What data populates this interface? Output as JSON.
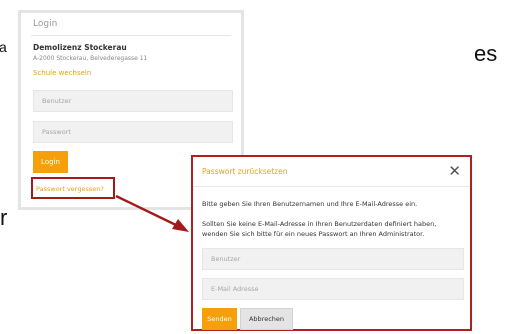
{
  "background_text": {
    "left_char_top": "a",
    "right_fragment": "es",
    "left_char_bottom": "r"
  },
  "login_panel": {
    "title": "Login",
    "company_name": "Demolizenz Stockerau",
    "company_address": "A-2000 Stockerau, Belvederegasse 11",
    "change_school_link": "Schule wechseln",
    "username_placeholder": "Benutzer",
    "password_placeholder": "Passwort",
    "login_button": "Login",
    "forgot_password_link": "Passwort vergessen?"
  },
  "reset_modal": {
    "title": "Passwort zurücksetzen",
    "close_glyph": "✕",
    "instruction_1": "Bitte geben Sie Ihren Benutzernamen und Ihre E-Mail-Adresse ein.",
    "instruction_2": "Sollten Sie keine E-Mail-Adresse in Ihren Benutzerdaten definiert haben, wenden Sie sich bitte für ein neues Passwort an Ihren Administrator.",
    "username_placeholder": "Benutzer",
    "email_placeholder": "E-Mail Adresse",
    "send_button": "Senden",
    "cancel_button": "Abbrechen"
  },
  "colors": {
    "accent": "#f5a00a",
    "link": "#e8a01c",
    "highlight": "#a31a1a"
  }
}
